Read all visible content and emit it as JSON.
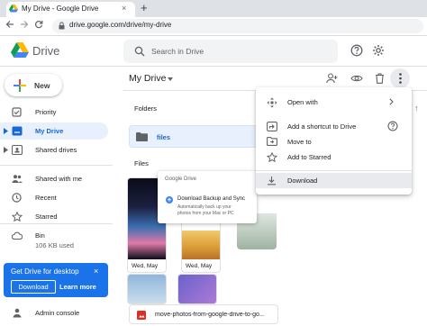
{
  "browser": {
    "tab_title": "My Drive - Google Drive",
    "tab_close": "×",
    "new_tab": "+",
    "url": "drive.google.com/drive/my-drive"
  },
  "header": {
    "app_name": "Drive",
    "search_placeholder": "Search in Drive"
  },
  "sidebar": {
    "new_label": "New",
    "items": [
      {
        "label": "Priority",
        "icon": "check-square-icon"
      },
      {
        "label": "My Drive",
        "icon": "my-drive-icon"
      },
      {
        "label": "Shared drives",
        "icon": "shared-drives-icon"
      },
      {
        "label": "Shared with me",
        "icon": "people-icon"
      },
      {
        "label": "Recent",
        "icon": "clock-icon"
      },
      {
        "label": "Starred",
        "icon": "star-icon"
      }
    ],
    "storage_label": "Bin",
    "storage_used": "106 KB used",
    "promo": {
      "title": "Get Drive for desktop",
      "close": "×",
      "download": "Download",
      "learn_more": "Learn more"
    },
    "admin_label": "Admin console"
  },
  "main": {
    "breadcrumb": "My Drive",
    "folders_heading": "Folders",
    "folder_name": "files",
    "files_heading": "Files",
    "thumb_caption_1": "Wed, May",
    "thumb_caption_2": "Wed, May",
    "popover_title": "Google Drive",
    "popover_item": "Download Backup and Sync",
    "popover_desc_1": "Automatically back up your",
    "popover_desc_2": "photos from your Mac or PC",
    "bottom_file": "move-photos-from-google-drive-to-go...",
    "sort_arrow": "↑"
  },
  "menu": {
    "items": [
      {
        "label": "Open with",
        "icon": "open-with-icon"
      },
      {
        "label": "Add a shortcut to Drive",
        "icon": "add-shortcut-icon"
      },
      {
        "label": "Move to",
        "icon": "move-to-icon"
      },
      {
        "label": "Add to Starred",
        "icon": "star-icon"
      },
      {
        "label": "Download",
        "icon": "download-icon"
      }
    ]
  },
  "colors": {
    "accent": "#1a73e8",
    "selected_bg": "#e8f0fe",
    "selected_text": "#1967d2"
  }
}
